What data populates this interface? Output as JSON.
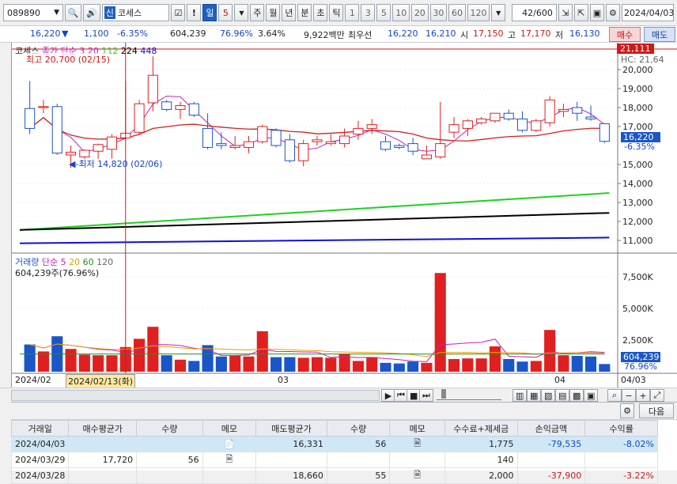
{
  "toolbar": {
    "code": "089890",
    "mode_badge": "신",
    "name": "코세스",
    "warn": "!",
    "period_day": "일",
    "period_num": "5",
    "periods": [
      "주",
      "월",
      "년",
      "분",
      "초",
      "틱"
    ],
    "intervals": [
      "1",
      "3",
      "5",
      "10",
      "20",
      "30",
      "60",
      "120"
    ],
    "count": "42",
    "count_total": "/600",
    "date": "2024/04/03"
  },
  "quote": {
    "price": "16,220",
    "arrow": "▼",
    "change": "1,100",
    "change_pct": "-6.35%",
    "volume": "604,239",
    "vol_ratio": "76.96%",
    "turnover": "3.64%",
    "amount": "9,922백만",
    "best_label": "최우선",
    "best_sell": "16,220",
    "best_buy": "16,210",
    "open_label": "시",
    "open": "17,150",
    "high_label": "고",
    "high": "17,170",
    "low_label": "저",
    "low": "16,130",
    "buy_label": "매수",
    "sell_label": "매도"
  },
  "price_panel": {
    "legend_name": "코세스",
    "legend_ma": "종가 단순 3 20",
    "ma112": "112",
    "ma224": "224",
    "ma448": "448",
    "max_marker": "최고 20,700 (02/15)",
    "min_marker": "최저 14,820 (02/06)",
    "current_label": "16,220",
    "current_pct": "-6.35%",
    "top_label": "21,111",
    "hc_label": "HC: 21,64",
    "y_ticks": [
      "20,000",
      "19,000",
      "18,000",
      "17,000",
      "15,000",
      "14,000",
      "13,000",
      "12,000",
      "11,000"
    ]
  },
  "volume_panel": {
    "legend": "거래량",
    "legend_ma": "단순 5",
    "ma20": "20",
    "ma60": "60",
    "ma120": "120",
    "sub": "604,239주(76.96%)",
    "y_ticks": [
      "7,500K",
      "5,000K",
      "2,500K"
    ],
    "current": "604,239",
    "current_pct": "76.96%"
  },
  "x_axis": {
    "labels": [
      "2024/02",
      "2024/02/13(화)",
      "03",
      "04",
      "04/03"
    ]
  },
  "table_bar": {
    "next_label": "다음"
  },
  "table": {
    "headers": [
      "거래일",
      "매수평균가",
      "수량",
      "메모",
      "매도평균가",
      "수량",
      "메모",
      "수수료+제세금",
      "손익금액",
      "수익률"
    ],
    "rows": [
      [
        "2024/04/03",
        "",
        "",
        "",
        "16,331",
        "56",
        "",
        "1,775",
        "-79,535",
        "-8.02%"
      ],
      [
        "2024/03/29",
        "17,720",
        "56",
        "",
        "",
        "",
        "",
        "140",
        "",
        ""
      ],
      [
        "2024/03/28",
        "",
        "",
        "",
        "18,660",
        "55",
        "",
        "2,000",
        "-37,900",
        "-3.22%"
      ]
    ]
  },
  "colors": {
    "up": "#e02020",
    "down": "#1a56c8",
    "ma3": "#c020c0",
    "ma20": "#d02020",
    "ma112": "#20d020",
    "ma224": "#000000",
    "ma448": "#1010d0"
  },
  "chart_data": {
    "type": "candlestick",
    "dates": [
      "01/31",
      "02/01",
      "02/02",
      "02/05",
      "02/06",
      "02/07",
      "02/08",
      "02/13",
      "02/14",
      "02/15",
      "02/16",
      "02/19",
      "02/20",
      "02/21",
      "02/22",
      "02/23",
      "02/26",
      "02/27",
      "02/28",
      "02/29",
      "03/04",
      "03/05",
      "03/06",
      "03/07",
      "03/08",
      "03/11",
      "03/12",
      "03/13",
      "03/14",
      "03/15",
      "03/18",
      "03/19",
      "03/20",
      "03/21",
      "03/22",
      "03/25",
      "03/26",
      "03/27",
      "03/28",
      "03/29",
      "04/01",
      "04/02",
      "04/03"
    ],
    "candles": [
      {
        "o": 17950,
        "h": 19400,
        "l": 16600,
        "c": 16900
      },
      {
        "o": 18000,
        "h": 18400,
        "l": 17700,
        "c": 18050
      },
      {
        "o": 18050,
        "h": 18200,
        "l": 15500,
        "c": 15600
      },
      {
        "o": 15500,
        "h": 16000,
        "l": 14820,
        "c": 15650
      },
      {
        "o": 15400,
        "h": 15800,
        "l": 15300,
        "c": 15750
      },
      {
        "o": 15700,
        "h": 16100,
        "l": 15300,
        "c": 16050
      },
      {
        "o": 15800,
        "h": 16600,
        "l": 15300,
        "c": 16450
      },
      {
        "o": 16400,
        "h": 19400,
        "l": 16300,
        "c": 16650
      },
      {
        "o": 16700,
        "h": 18400,
        "l": 16600,
        "c": 18200
      },
      {
        "o": 18250,
        "h": 20700,
        "l": 17800,
        "c": 19700
      },
      {
        "o": 18300,
        "h": 18400,
        "l": 17800,
        "c": 17900
      },
      {
        "o": 17900,
        "h": 18300,
        "l": 17400,
        "c": 18100
      },
      {
        "o": 18200,
        "h": 18300,
        "l": 17500,
        "c": 17600
      },
      {
        "o": 16900,
        "h": 17700,
        "l": 15800,
        "c": 15900
      },
      {
        "o": 16100,
        "h": 16700,
        "l": 15800,
        "c": 16000
      },
      {
        "o": 15900,
        "h": 16500,
        "l": 15800,
        "c": 16000
      },
      {
        "o": 15900,
        "h": 16500,
        "l": 15600,
        "c": 16200
      },
      {
        "o": 16200,
        "h": 17100,
        "l": 16100,
        "c": 17000
      },
      {
        "o": 16800,
        "h": 16900,
        "l": 15900,
        "c": 16000
      },
      {
        "o": 16300,
        "h": 16600,
        "l": 15100,
        "c": 15200
      },
      {
        "o": 15200,
        "h": 16300,
        "l": 14900,
        "c": 16100
      },
      {
        "o": 16200,
        "h": 16500,
        "l": 16000,
        "c": 16300
      },
      {
        "o": 16100,
        "h": 16600,
        "l": 16000,
        "c": 16200
      },
      {
        "o": 16100,
        "h": 16900,
        "l": 15900,
        "c": 16500
      },
      {
        "o": 16600,
        "h": 17300,
        "l": 16300,
        "c": 16900
      },
      {
        "o": 16900,
        "h": 17400,
        "l": 16600,
        "c": 17100
      },
      {
        "o": 16200,
        "h": 16500,
        "l": 15700,
        "c": 15800
      },
      {
        "o": 16000,
        "h": 16100,
        "l": 15800,
        "c": 15900
      },
      {
        "o": 16100,
        "h": 16400,
        "l": 15500,
        "c": 15700
      },
      {
        "o": 15300,
        "h": 16000,
        "l": 15300,
        "c": 15500
      },
      {
        "o": 15400,
        "h": 18300,
        "l": 15300,
        "c": 16100
      },
      {
        "o": 16700,
        "h": 17500,
        "l": 16400,
        "c": 17100
      },
      {
        "o": 16900,
        "h": 17400,
        "l": 16500,
        "c": 17300
      },
      {
        "o": 17200,
        "h": 17500,
        "l": 17100,
        "c": 17400
      },
      {
        "o": 17300,
        "h": 17700,
        "l": 17200,
        "c": 17700
      },
      {
        "o": 17700,
        "h": 17900,
        "l": 17300,
        "c": 17400
      },
      {
        "o": 17400,
        "h": 17800,
        "l": 16700,
        "c": 16800
      },
      {
        "o": 16800,
        "h": 17400,
        "l": 16700,
        "c": 17300
      },
      {
        "o": 17200,
        "h": 18600,
        "l": 17000,
        "c": 18400
      },
      {
        "o": 17800,
        "h": 18200,
        "l": 17500,
        "c": 17900
      },
      {
        "o": 18000,
        "h": 18300,
        "l": 17300,
        "c": 17700
      },
      {
        "o": 17500,
        "h": 18100,
        "l": 17300,
        "c": 17400
      },
      {
        "o": 17150,
        "h": 17170,
        "l": 16130,
        "c": 16220
      }
    ],
    "volume": [
      2150,
      1600,
      2800,
      1800,
      1350,
      1300,
      1300,
      1950,
      2600,
      3550,
      1300,
      950,
      850,
      2100,
      1200,
      1250,
      1200,
      3200,
      1150,
      1150,
      1100,
      1150,
      1100,
      1400,
      850,
      1150,
      700,
      650,
      800,
      700,
      7800,
      1000,
      1050,
      1050,
      2000,
      1000,
      800,
      850,
      3300,
      1300,
      1250,
      1200,
      604
    ],
    "ma112": [
      11550,
      13500
    ],
    "ma224": [
      11550,
      12450
    ],
    "ma448": [
      10850,
      11150
    ],
    "price_range": [
      10500,
      21000
    ],
    "volume_max": 8500
  }
}
